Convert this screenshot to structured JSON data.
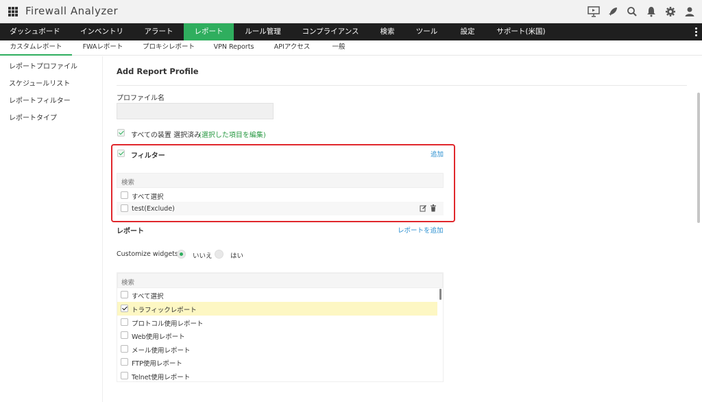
{
  "app": {
    "title": "Firewall Analyzer"
  },
  "top_icons": [
    "presentation-icon",
    "rocket-icon",
    "search-icon",
    "bell-icon",
    "gear-icon",
    "user-icon"
  ],
  "main_nav": [
    {
      "label": "ダッシュボード"
    },
    {
      "label": "インベントリ"
    },
    {
      "label": "アラート"
    },
    {
      "label": "レポート",
      "active": true
    },
    {
      "label": "ルール管理"
    },
    {
      "label": "コンプライアンス"
    },
    {
      "label": "検索"
    },
    {
      "label": "ツール"
    },
    {
      "label": "設定"
    },
    {
      "label": "サポート(米国)"
    }
  ],
  "sub_nav": [
    {
      "label": "カスタムレポート",
      "active": true
    },
    {
      "label": "FWAレポート"
    },
    {
      "label": "プロキシレポート"
    },
    {
      "label": "VPN Reports"
    },
    {
      "label": "APIアクセス"
    },
    {
      "label": "一般"
    }
  ],
  "sidebar": {
    "items": [
      {
        "label": "レポートプロファイル"
      },
      {
        "label": "スケジュールリスト"
      },
      {
        "label": "レポートフィルター"
      },
      {
        "label": "レポートタイプ"
      }
    ]
  },
  "form": {
    "title": "Add Report Profile",
    "profile_name_label": "プロファイル名",
    "profile_name_value": "",
    "devices_label": "すべての装置 選択済み",
    "devices_edit_link": "(選択した項目を編集)",
    "filter": {
      "label": "フィルター",
      "add_link": "追加",
      "search_placeholder": "検索",
      "select_all": "すべて選択",
      "items": [
        {
          "label": "test(Exclude)"
        }
      ]
    },
    "report": {
      "label": "レポート",
      "add_link": "レポートを追加",
      "customize_label": "Customize widgets :",
      "option_no": "いいえ",
      "option_yes": "はい",
      "search_placeholder": "検索",
      "select_all": "すべて選択",
      "items": [
        {
          "label": "トラフィックレポート",
          "checked": true
        },
        {
          "label": "プロトコル使用レポート",
          "checked": false
        },
        {
          "label": "Web使用レポート",
          "checked": false
        },
        {
          "label": "メール使用レポート",
          "checked": false
        },
        {
          "label": "FTP使用レポート",
          "checked": false
        },
        {
          "label": "Telnet使用レポート",
          "checked": false
        }
      ]
    }
  },
  "colors": {
    "accent": "#2fae5e",
    "highlight": "#e0262b",
    "nav_bg": "#1f1f1f",
    "link": "#2a8fd0"
  }
}
